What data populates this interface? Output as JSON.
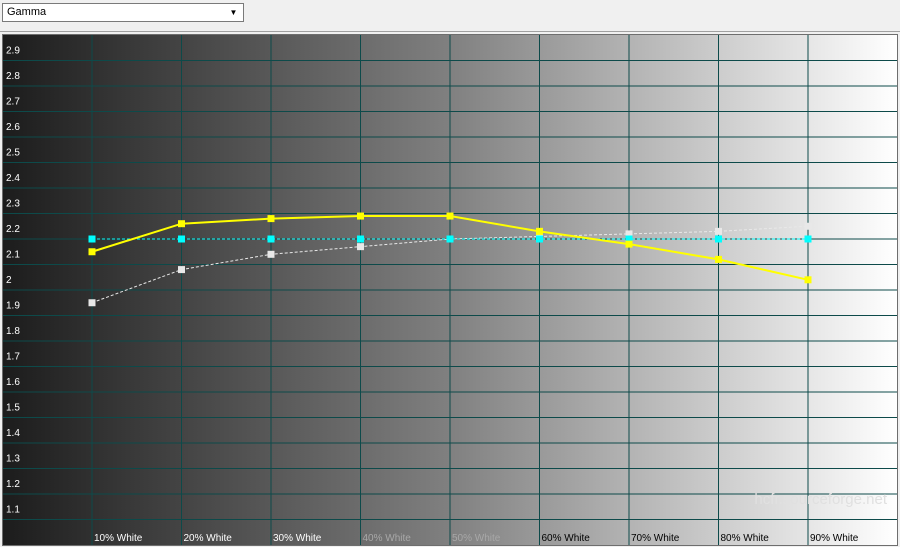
{
  "toolbar": {
    "view_select": {
      "value": "Gamma",
      "icon": "chevron-down-icon"
    }
  },
  "watermark": "hcfr.sourceforge.net",
  "colors": {
    "measured": "#ffff00",
    "reference": "#00ffff",
    "second_measure": "#e8e8e8",
    "grid": "#0d4a4a"
  },
  "chart_data": {
    "type": "line",
    "categories": [
      "10% White",
      "20% White",
      "30% White",
      "40% White",
      "50% White",
      "60% White",
      "70% White",
      "80% White",
      "90% White"
    ],
    "y_ticks": [
      "1.1",
      "1.2",
      "1.3",
      "1.4",
      "1.5",
      "1.6",
      "1.7",
      "1.8",
      "1.9",
      "2",
      "2.1",
      "2.2",
      "2.3",
      "2.4",
      "2.5",
      "2.6",
      "2.7",
      "2.8",
      "2.9"
    ],
    "ylim": [
      1.0,
      3.0
    ],
    "grid": true,
    "legend": "none",
    "series": [
      {
        "key": "measured",
        "style": "solid",
        "values": [
          2.15,
          2.26,
          2.28,
          2.29,
          2.29,
          2.23,
          2.18,
          2.12,
          2.04
        ]
      },
      {
        "key": "reference",
        "style": "dashed",
        "values": [
          2.2,
          2.2,
          2.2,
          2.2,
          2.2,
          2.2,
          2.2,
          2.2,
          2.2
        ]
      },
      {
        "key": "second_measure",
        "style": "dashed",
        "values": [
          1.95,
          2.08,
          2.14,
          2.17,
          2.2,
          2.21,
          2.22,
          2.23,
          2.25
        ]
      }
    ]
  }
}
